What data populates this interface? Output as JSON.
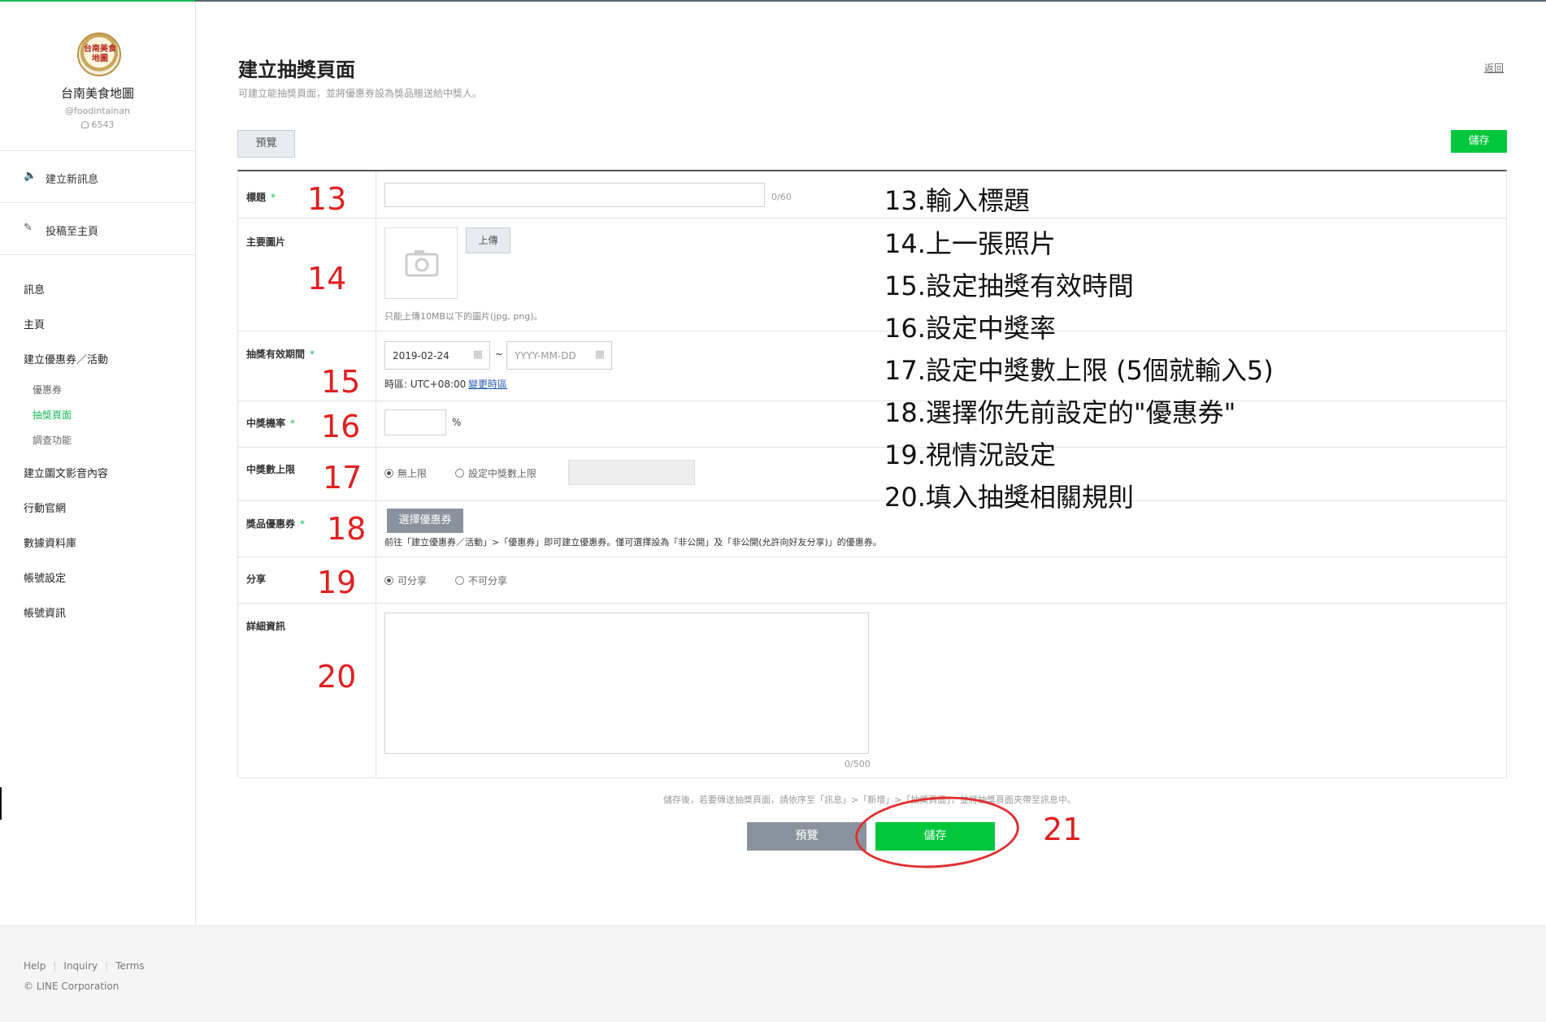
{
  "sidebar": {
    "profile": {
      "logo_text": "台南美食地圖",
      "name": "台南美食地圖",
      "handle": "@foodintainan",
      "friends": "6543"
    },
    "actions": [
      {
        "label": "建立新訊息",
        "icon": "megaphone-icon"
      },
      {
        "label": "投稿至主頁",
        "icon": "edit-icon"
      }
    ],
    "nav": {
      "messages": "訊息",
      "home": "主頁",
      "coupons_events": "建立優惠券／活動",
      "coupon": "優惠券",
      "lottery": "抽獎頁面",
      "survey": "調查功能",
      "rich_content": "建立圖文影音內容",
      "mobile_site": "行動官網",
      "database": "數據資料庫",
      "account_settings": "帳號設定",
      "account_info": "帳號資訊"
    }
  },
  "header": {
    "title": "建立抽獎頁面",
    "subtitle": "可建立能抽獎頁面，並將優惠券設為獎品贈送給中獎人。",
    "back": "返回",
    "preview": "預覽",
    "save": "儲存"
  },
  "form": {
    "title": {
      "label": "標題",
      "required": "*",
      "value": "",
      "counter": "0/60",
      "step": "13"
    },
    "image": {
      "label": "主要圖片",
      "upload": "上傳",
      "hint": "只能上傳10MB以下的圖片(jpg, png)。",
      "step": "14"
    },
    "period": {
      "label": "抽獎有效期間",
      "required": "*",
      "start": "2019-02-24",
      "tilde": "~",
      "end_placeholder": "YYYY-MM-DD",
      "timezone_label": "時區: UTC+08:00",
      "timezone_link": "變更時區",
      "step": "15"
    },
    "rate": {
      "label": "中獎機率",
      "required": "*",
      "value": "",
      "unit": "%",
      "step": "16"
    },
    "limit": {
      "label": "中獎數上限",
      "opt_unlimited": "無上限",
      "opt_set": "設定中獎數上限",
      "value": "",
      "step": "17"
    },
    "coupon": {
      "label": "獎品優惠券",
      "required": "*",
      "button": "選擇優惠券",
      "note": "前往「建立優惠券／活動」>「優惠券」即可建立優惠券。僅可選擇設為「非公開」及「非公開(允許向好友分享)」的優惠券。",
      "step": "18"
    },
    "share": {
      "label": "分享",
      "opt_yes": "可分享",
      "opt_no": "不可分享",
      "step": "19"
    },
    "details": {
      "label": "詳細資訊",
      "value": "",
      "counter": "0/500",
      "step": "20"
    }
  },
  "annotations": [
    "13.輸入標題",
    "14.上一張照片",
    "15.設定抽獎有效時間",
    "16.設定中獎率",
    "17.設定中獎數上限 (5個就輸入5)",
    "18.選擇你先前設定的\"優惠券\"",
    "19.視情況設定",
    "20.填入抽獎相關規則"
  ],
  "bottom": {
    "note": "儲存後，若要傳送抽獎頁面，請依序至「訊息」>「新增」>「抽獎頁面」，並將抽獎頁面夾帶至訊息中。",
    "preview": "預覽",
    "save": "儲存",
    "step": "21"
  },
  "footer": {
    "help": "Help",
    "inquiry": "Inquiry",
    "terms": "Terms",
    "copyright": "© LINE Corporation"
  },
  "colors": {
    "accent": "#00c73c",
    "annotation_red": "#e02020",
    "gray_button": "#8a939d"
  }
}
